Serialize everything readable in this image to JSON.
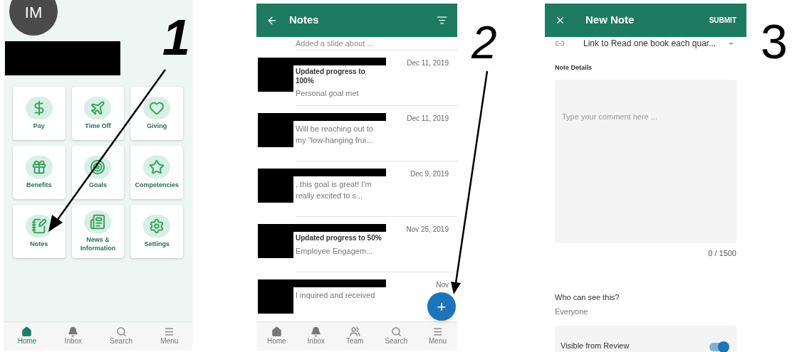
{
  "annotations": [
    "1",
    "2",
    "3"
  ],
  "home": {
    "avatar": "IM",
    "tiles": [
      {
        "label": "Pay"
      },
      {
        "label": "Time Off"
      },
      {
        "label": "Giving"
      },
      {
        "label": "Benefits"
      },
      {
        "label": "Goals"
      },
      {
        "label": "Competencies"
      },
      {
        "label": "Notes"
      },
      {
        "label": "News & Information"
      },
      {
        "label": "Settings"
      }
    ],
    "nav": [
      {
        "label": "Home",
        "selected": true
      },
      {
        "label": "Inbox",
        "selected": false
      },
      {
        "label": "Search",
        "selected": false
      },
      {
        "label": "Menu",
        "selected": false
      }
    ]
  },
  "notes": {
    "title": "Notes",
    "top_text": "Added a slide about ...",
    "items": [
      {
        "date": "Dec 11, 2019",
        "lines": [
          {
            "kind": "bold",
            "text": "Updated progress to 100%"
          },
          {
            "kind": "plain",
            "text": "Personal goal met"
          }
        ]
      },
      {
        "date": "Dec 11, 2019",
        "lines": [
          {
            "kind": "plain",
            "text": "Will be reaching out to my \"low-hanging frui..."
          }
        ]
      },
      {
        "date": "Dec 9, 2019",
        "lines": [
          {
            "kind": "plain",
            "text": ", this goal is great! I'm really excited to s..."
          }
        ]
      },
      {
        "date": "Nov 25, 2019",
        "lines": [
          {
            "kind": "bold",
            "text": "Updated progress to 50%"
          },
          {
            "kind": "plain",
            "text": "Employee Engagem..."
          }
        ]
      },
      {
        "date": "Nov",
        "lines": [
          {
            "kind": "plain",
            "text": "I inquired and received"
          }
        ]
      }
    ],
    "fab": "+",
    "nav": [
      {
        "label": "Home",
        "selected": false
      },
      {
        "label": "Inbox",
        "selected": false
      },
      {
        "label": "Team",
        "selected": false
      },
      {
        "label": "Search",
        "selected": false
      },
      {
        "label": "Menu",
        "selected": false
      }
    ]
  },
  "new_note": {
    "title": "New Note",
    "submit": "SUBMIT",
    "link": "Link to Read one book each quar...",
    "details_label": "Note Details",
    "placeholder": "Type your comment here ...",
    "counter": "0 / 1500",
    "visibility_label": "Who can see this?",
    "visibility_value": "Everyone",
    "toggle": {
      "label": "Visible from Review",
      "on": true
    }
  }
}
